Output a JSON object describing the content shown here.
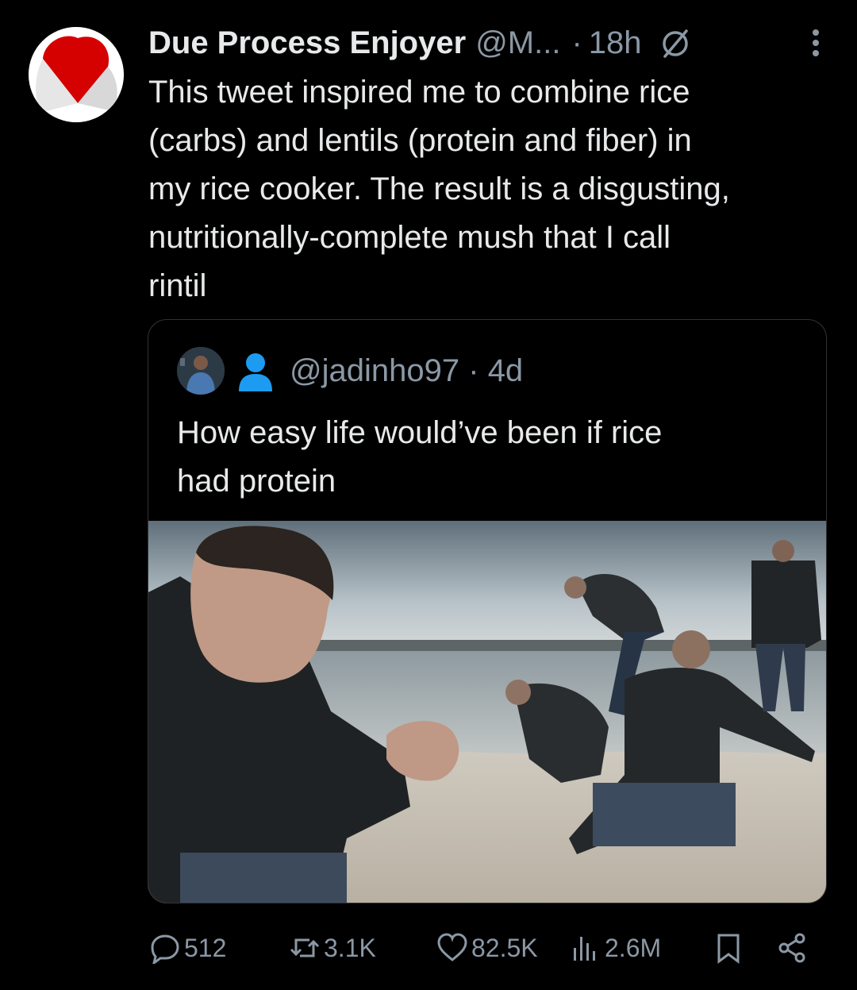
{
  "tweet": {
    "author_name": "Due Process Enjoyer",
    "author_handle": "@M...",
    "separator": "·",
    "time": "18h",
    "text": "This tweet inspired me to combine rice\n(carbs) and lentils (protein and fiber) in\nmy rice cooker.  The result is a disgusting,\nnutritionally-complete mush that I call\nrintil"
  },
  "quote": {
    "handle": "@jadinho97",
    "separator": "·",
    "time": "4d",
    "text": "How easy life would’ve been if rice\nhad protein"
  },
  "actions": {
    "replies": "512",
    "retweets": "3.1K",
    "likes": "82.5K",
    "views": "2.6M"
  },
  "colors": {
    "background": "#000000",
    "text": "#e7e9ea",
    "muted": "#8b98a5",
    "border": "#2f3336",
    "person_icon": "#1d9bf0"
  },
  "icons": {
    "badge": "no-symbol-icon",
    "more": "more-vertical-icon",
    "person": "person-icon",
    "reply": "reply-icon",
    "retweet": "retweet-icon",
    "like": "heart-icon",
    "views": "views-icon",
    "bookmark": "bookmark-icon",
    "share": "share-icon"
  }
}
